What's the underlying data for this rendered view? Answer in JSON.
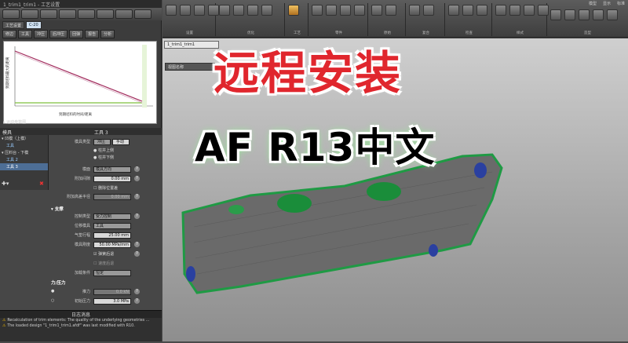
{
  "window": {
    "title": "1_trim1_trim1 - 工艺设置"
  },
  "left_tabs": [
    "工艺设置",
    "C-20"
  ],
  "left_buttons": [
    "修边",
    "工具",
    "冲压",
    "后冲压",
    "回弹",
    "报告",
    "分析"
  ],
  "chart": {
    "ylabel": "到期坯料最大的距离",
    "xlabel": "到期坯料的时间/距离",
    "footer": "运动参数图"
  },
  "tool_panel": {
    "header_left": "模具",
    "header_center": "工具 3"
  },
  "tree": {
    "items": [
      {
        "label": "凹模（上模）",
        "child": false,
        "selected": false
      },
      {
        "label": "工具",
        "child": true,
        "selected": false
      },
      {
        "label": "压料台 - 下模",
        "child": false,
        "selected": false
      },
      {
        "label": "工具 2",
        "child": true,
        "selected": false
      },
      {
        "label": "工具 3",
        "child": true,
        "selected": true
      }
    ]
  },
  "props": {
    "mold_label": "模具类型",
    "mold_btn1": "冲压",
    "mold_btn2": "手动",
    "radio1": "柱井上侧",
    "radio2": "柱井下侧",
    "dir_label": "模面",
    "dir_value": "模具方向",
    "offset_label": "附加间隙",
    "offset_value": "0.00 mm",
    "chk_label": "删除位置差",
    "extra_label": "附加高差半径",
    "extra_value": "0.00 mm",
    "section_support": "支撑",
    "ctrl_label": "控制类型",
    "ctrl_value": "受力控制",
    "pos_label": "位移模具",
    "pos_value": "工具",
    "stroke_label": "气垫行程",
    "stroke_value": "25.00 mm",
    "press_label": "模具刚度",
    "press_value": "50.00 MPa/mm",
    "cb1": "弹簧后退",
    "cb2": "速度后退",
    "load_label": "加载条件",
    "load_value": "恒定",
    "section_force": "力/压力",
    "force_label": "推力",
    "force_value": "0.0 kN",
    "pressure_label": "初始压力",
    "pressure_value": "3.0 MPa"
  },
  "log": {
    "title": "日志消息",
    "lines": [
      "Recalculation of trim elements: The quality of the underlying geometries ...",
      "The loaded design \"1_trim1_trim1.afdf\" was last modified with R10."
    ]
  },
  "ribbon": {
    "groups": [
      "设置",
      "优化",
      "工艺",
      "零件",
      "原始",
      "复合",
      "检查",
      "样式",
      "造型"
    ],
    "tabs": [
      "模型",
      "显示",
      "标准"
    ]
  },
  "viewport": {
    "doc_tab": "1_trim1_trim1",
    "tree_label": "视图名称"
  },
  "overlay": {
    "title": "远程安装",
    "subtitle": "AF R13中文"
  }
}
